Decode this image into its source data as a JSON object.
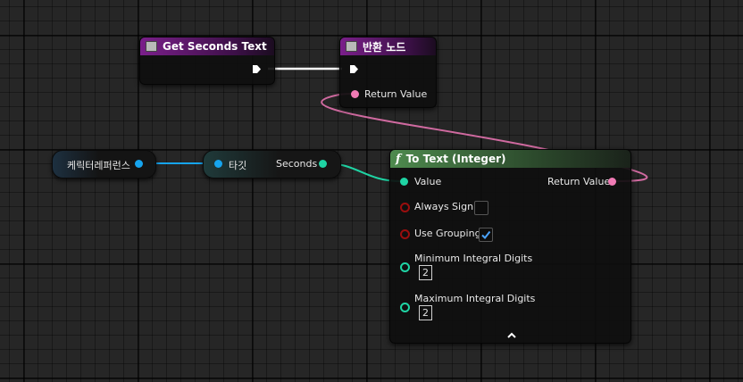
{
  "nodes": {
    "get_seconds_text": {
      "title": "Get Seconds Text"
    },
    "return_node": {
      "title": "반환 노드",
      "return_value_label": "Return Value"
    },
    "character_ref": {
      "label": "케릭터레퍼런스"
    },
    "target": {
      "target_label": "타깃",
      "seconds_label": "Seconds"
    },
    "to_text_integer": {
      "title": "To Text (Integer)",
      "value_label": "Value",
      "return_value_label": "Return Value",
      "always_sign_label": "Always Sign",
      "use_grouping_label": "Use Grouping",
      "min_digits_label": "Minimum Integral Digits",
      "min_digits_value": "2",
      "max_digits_label": "Maximum Integral Digits",
      "max_digits_value": "2",
      "always_sign_checked": false,
      "use_grouping_checked": true
    }
  },
  "icons": {
    "function": "function-icon",
    "expand": "chevron-up-icon",
    "check": "checkmark-icon"
  },
  "colors": {
    "header_purple": "#7a1f8a",
    "header_green": "#4e8a4e",
    "pin_text": "#f07ab4",
    "pin_integer": "#1fd4a4",
    "pin_object": "#16a4ee",
    "pin_bool": "#9a0e0e",
    "exec_wire": "#ffffff"
  }
}
